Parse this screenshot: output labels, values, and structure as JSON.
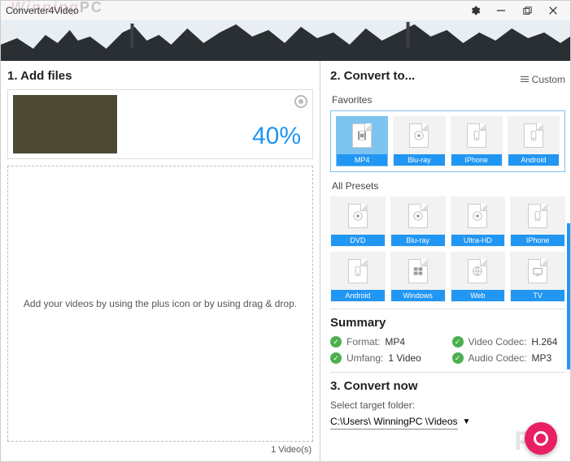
{
  "titlebar": {
    "title": "Converter4Video",
    "watermark_left": "Winning",
    "watermark_pc": "PC"
  },
  "left": {
    "section_title": "1. Add files",
    "progress_percent": "40%",
    "dropzone_text": "Add your videos by using the plus icon or by using drag & drop.",
    "file_count": "1 Video(s)"
  },
  "right": {
    "section_title": "2. Convert to...",
    "custom_label": "Custom",
    "favorites_label": "Favorites",
    "favorites": [
      {
        "label": "MP4",
        "icon": "film",
        "selected": true
      },
      {
        "label": "Blu-ray",
        "icon": "disc",
        "selected": false
      },
      {
        "label": "IPhone",
        "icon": "phone",
        "selected": false
      },
      {
        "label": "Android",
        "icon": "phone",
        "selected": false
      }
    ],
    "allpresets_label": "All Presets",
    "allpresets": [
      {
        "label": "DVD",
        "icon": "disc"
      },
      {
        "label": "Blu-ray",
        "icon": "disc"
      },
      {
        "label": "Ultra-HD",
        "icon": "disc"
      },
      {
        "label": "IPhone",
        "icon": "phone"
      },
      {
        "label": "Android",
        "icon": "phone"
      },
      {
        "label": "Windows",
        "icon": "windows"
      },
      {
        "label": "Web",
        "icon": "web"
      },
      {
        "label": "TV",
        "icon": "tv"
      }
    ],
    "summary_title": "Summary",
    "summary": {
      "format_key": "Format:",
      "format_val": "MP4",
      "videocodec_key": "Video Codec:",
      "videocodec_val": "H.264",
      "umfang_key": "Umfang:",
      "umfang_val": "1 Video",
      "audiocodec_key": "Audio Codec:",
      "audiocodec_val": "MP3"
    },
    "convert_title": "3. Convert now",
    "folder_label": "Select target folder:",
    "folder_path": "C:\\Users\\ WinningPC \\Videos",
    "watermark_pc": "PC"
  }
}
